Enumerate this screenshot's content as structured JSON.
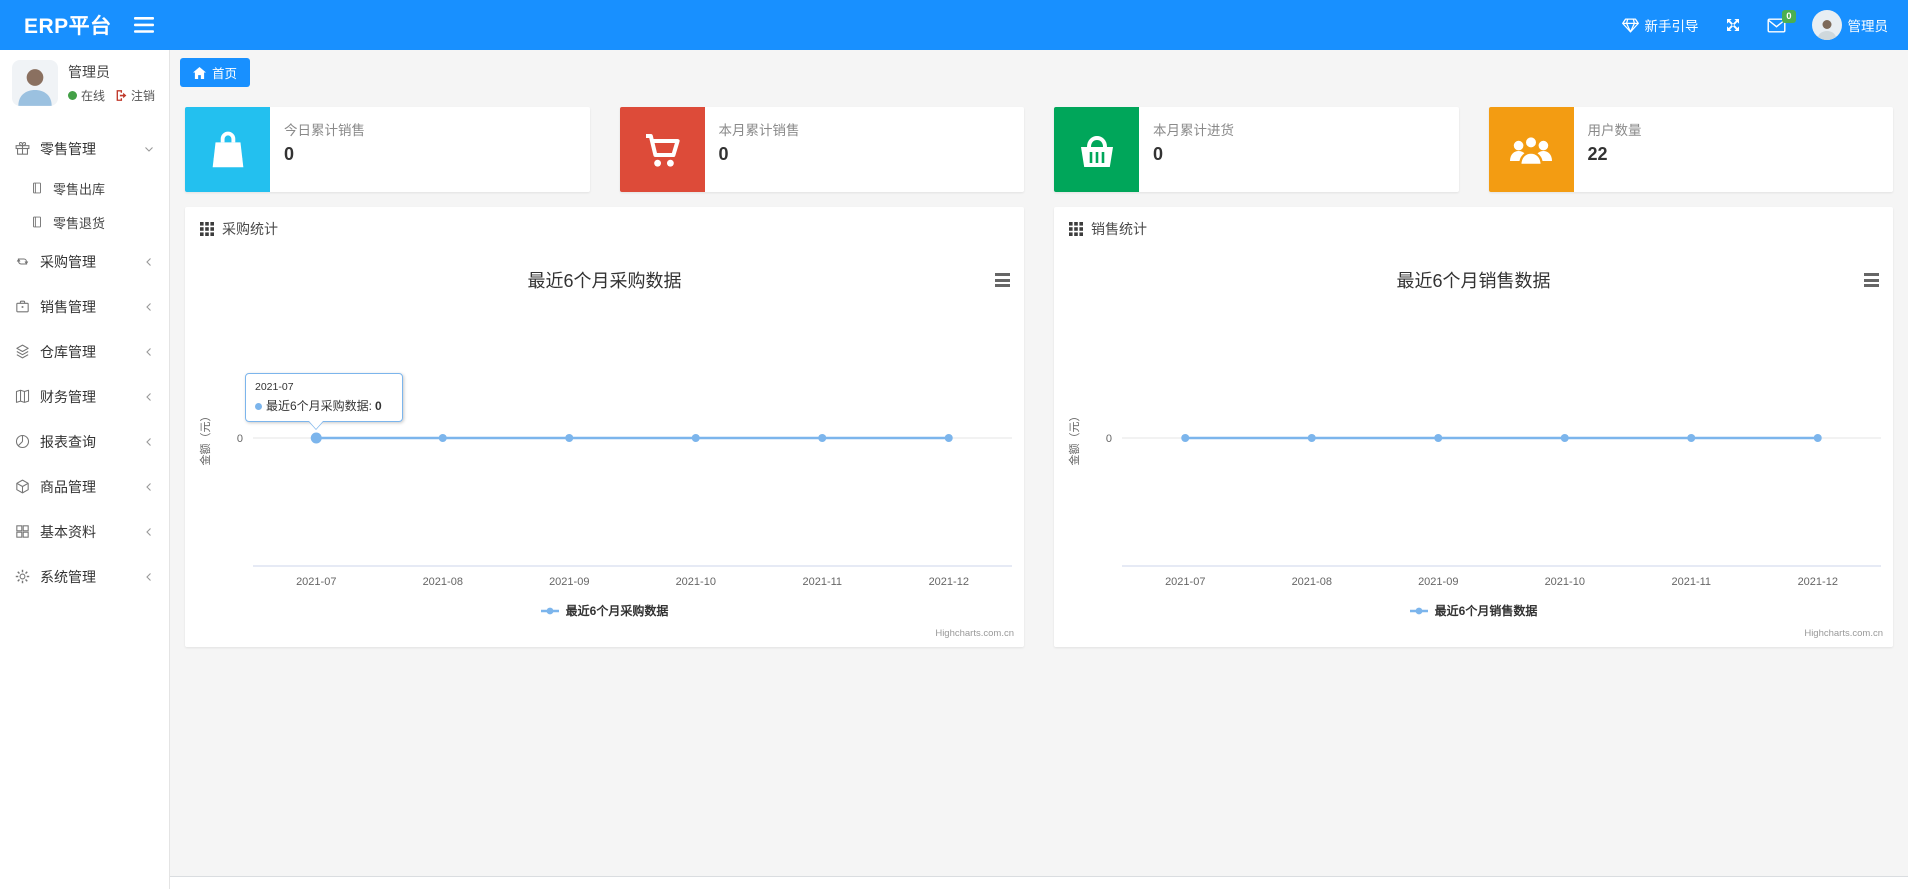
{
  "colors": {
    "navbar": "#1890ff",
    "badge_green": "#4caf50",
    "online_green": "#43a047",
    "chart_line": "#7cb5ec",
    "axis_line": "#ccd6eb",
    "grid_line": "#e6e6e6"
  },
  "navbar": {
    "brand": "ERP平台",
    "guide_label": "新手引导",
    "mail_badge": "0",
    "user_name": "管理员"
  },
  "sidebar": {
    "user": {
      "name": "管理员",
      "status": "在线",
      "logout": "注销"
    },
    "items": [
      {
        "label": "零售管理",
        "icon": "gift-icon",
        "state": "expanded",
        "children": [
          {
            "label": "零售出库",
            "icon": "journal-icon"
          },
          {
            "label": "零售退货",
            "icon": "journal-icon"
          }
        ]
      },
      {
        "label": "采购管理",
        "icon": "procurement-loop-icon"
      },
      {
        "label": "销售管理",
        "icon": "briefcase-icon"
      },
      {
        "label": "仓库管理",
        "icon": "layers-icon"
      },
      {
        "label": "财务管理",
        "icon": "folded-map-icon"
      },
      {
        "label": "报表查询",
        "icon": "pie-chart-icon"
      },
      {
        "label": "商品管理",
        "icon": "cube-icon"
      },
      {
        "label": "基本资料",
        "icon": "grid-icon"
      },
      {
        "label": "系统管理",
        "icon": "gear-icon"
      }
    ]
  },
  "tabs": {
    "home": "首页"
  },
  "cards": [
    {
      "label": "今日累计销售",
      "value": "0",
      "color": "#23c0ef",
      "icon": "shopping-bag-icon"
    },
    {
      "label": "本月累计销售",
      "value": "0",
      "color": "#dd4b39",
      "icon": "shopping-cart-icon"
    },
    {
      "label": "本月累计进货",
      "value": "0",
      "color": "#00a65a",
      "icon": "shopping-basket-icon"
    },
    {
      "label": "用户数量",
      "value": "22",
      "color": "#f39c12",
      "icon": "users-icon"
    }
  ],
  "panels": [
    {
      "title": "采购统计"
    },
    {
      "title": "销售统计"
    }
  ],
  "chart_data": [
    {
      "type": "line",
      "title": "最近6个月采购数据",
      "categories": [
        "2021-07",
        "2021-08",
        "2021-09",
        "2021-10",
        "2021-11",
        "2021-12"
      ],
      "series": [
        {
          "name": "最近6个月采购数据",
          "values": [
            0,
            0,
            0,
            0,
            0,
            0
          ]
        }
      ],
      "xlabel": "",
      "ylabel": "金额（元）",
      "yticks": [
        0
      ],
      "line_color": "#7cb5ec",
      "grid": true,
      "legend_position": "bottom",
      "credits": "Highcharts.com.cn",
      "tooltip": {
        "visible": true,
        "point_index": 0,
        "date": "2021-07",
        "series_label": "最近6个月采购数据:",
        "value": "0"
      }
    },
    {
      "type": "line",
      "title": "最近6个月销售数据",
      "categories": [
        "2021-07",
        "2021-08",
        "2021-09",
        "2021-10",
        "2021-11",
        "2021-12"
      ],
      "series": [
        {
          "name": "最近6个月销售数据",
          "values": [
            0,
            0,
            0,
            0,
            0,
            0
          ]
        }
      ],
      "xlabel": "",
      "ylabel": "金额（元）",
      "yticks": [
        0
      ],
      "line_color": "#7cb5ec",
      "grid": true,
      "legend_position": "bottom",
      "credits": "Highcharts.com.cn",
      "tooltip": {
        "visible": false
      }
    }
  ]
}
